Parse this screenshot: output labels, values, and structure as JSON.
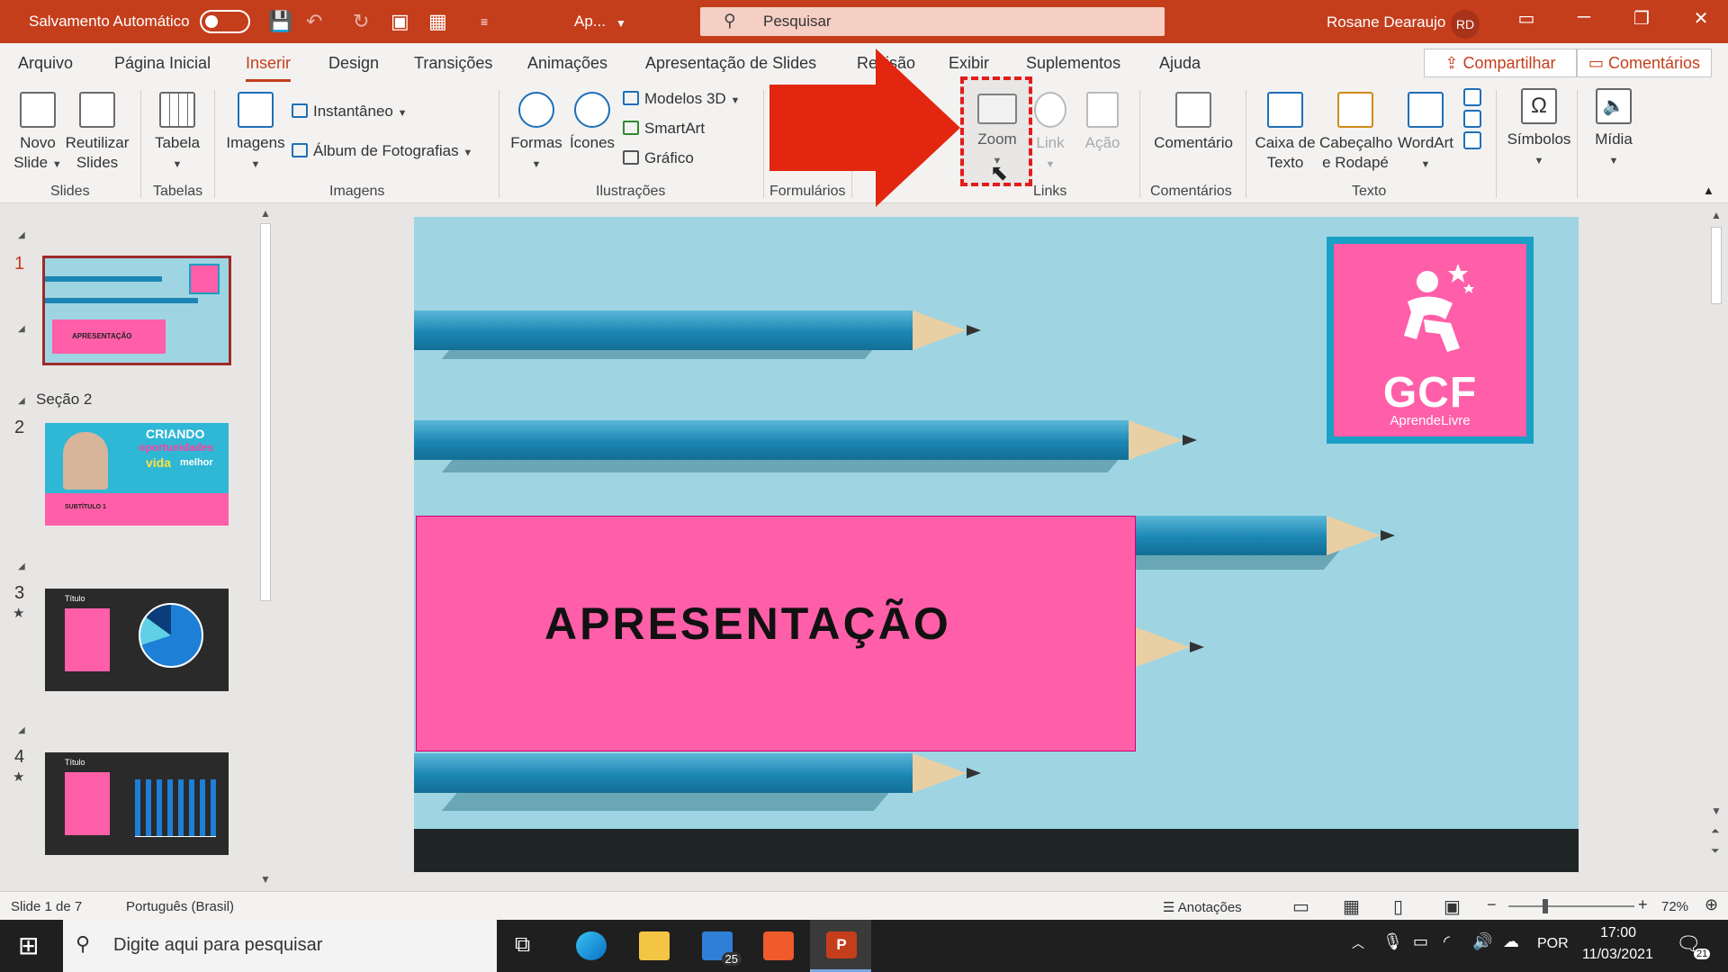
{
  "titlebar": {
    "autosave_label": "Salvamento Automático",
    "doc_name": "Ap...",
    "search_placeholder": "Pesquisar",
    "user_name": "Rosane Dearaujo",
    "user_initials": "RD"
  },
  "tabs": [
    "Arquivo",
    "Página Inicial",
    "Inserir",
    "Design",
    "Transições",
    "Animações",
    "Apresentação de Slides",
    "Revisão",
    "Exibir",
    "Suplementos",
    "Ajuda"
  ],
  "tab_active": "Inserir",
  "share_label": "Compartilhar",
  "comments_label": "Comentários",
  "ribbon": {
    "novo_slide": "Novo Slide",
    "reutilizar": "Reutilizar Slides",
    "tabela": "Tabela",
    "imagens": "Imagens",
    "instantaneo": "Instantâneo",
    "album": "Álbum de Fotografias",
    "formas": "Formas",
    "icones": "Ícones",
    "modelos3d": "Modelos 3D",
    "smartart": "SmartArt",
    "grafico": "Gráfico",
    "zoom": "Zoom",
    "link": "Link",
    "acao": "Ação",
    "comentario": "Comentário",
    "caixa_texto": "Caixa de Texto",
    "cabecalho": "Cabeçalho e Rodapé",
    "wordart": "WordArt",
    "simbolos": "Símbolos",
    "midia": "Mídia",
    "groups": {
      "slides": "Slides",
      "tabelas": "Tabelas",
      "imagens": "Imagens",
      "ilustracoes": "Ilustrações",
      "formularios": "Formulários",
      "links": "Links",
      "comentarios": "Comentários",
      "texto": "Texto"
    }
  },
  "leftpane": {
    "section": "Seção 2",
    "slides": [
      {
        "num": "1"
      },
      {
        "num": "2"
      },
      {
        "num": "3"
      },
      {
        "num": "4"
      }
    ],
    "thumb_texts": {
      "t1": "APRESENTAÇÃO",
      "t2a": "CRIANDO",
      "t2b": "oportunidades",
      "t2c": "vida",
      "t2d": "melhor",
      "t2e": "SUBTÍTULO 1",
      "t3": "Título",
      "t4": "Título"
    }
  },
  "slide": {
    "title": "APRESENTAÇÃO",
    "logo_text": "GCF",
    "logo_sub": "AprendeLivre"
  },
  "statusbar": {
    "slide_info": "Slide 1 de 7",
    "language": "Português (Brasil)",
    "notes": "Anotações",
    "zoom": "72%"
  },
  "taskbar": {
    "search_placeholder": "Digite aqui para pesquisar",
    "mail_badge": "25",
    "lang": "POR",
    "time": "17:00",
    "date": "11/03/2021",
    "notif_count": "21"
  },
  "colors": {
    "accent": "#c43e1c",
    "highlight": "#e31c1c",
    "slide_bg": "#9fd5e2",
    "title_box": "#ff5fa8"
  }
}
